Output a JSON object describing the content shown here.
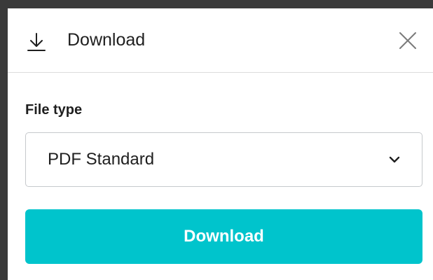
{
  "header": {
    "title": "Download",
    "icon": "download-icon",
    "close_icon": "close-icon"
  },
  "file_type": {
    "label": "File type",
    "selected": "PDF Standard",
    "icon": "chevron-down-icon"
  },
  "actions": {
    "download_label": "Download",
    "accent_color": "#00c4cc"
  }
}
